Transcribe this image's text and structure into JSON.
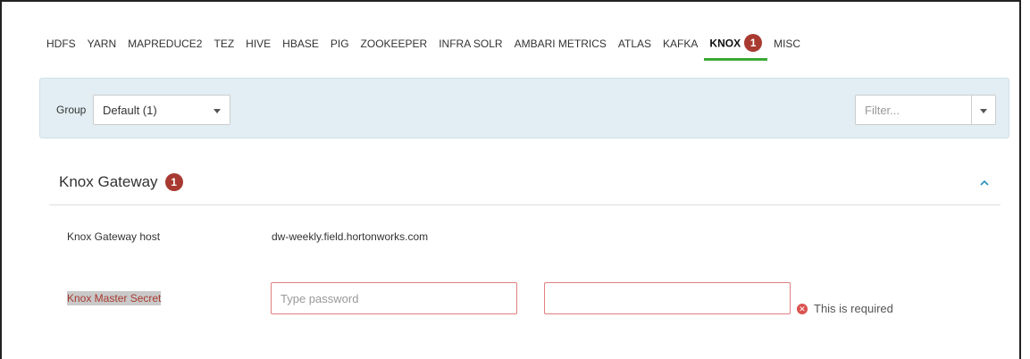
{
  "tabs": [
    {
      "label": "HDFS"
    },
    {
      "label": "YARN"
    },
    {
      "label": "MAPREDUCE2"
    },
    {
      "label": "TEZ"
    },
    {
      "label": "HIVE"
    },
    {
      "label": "HBASE"
    },
    {
      "label": "PIG"
    },
    {
      "label": "ZOOKEEPER"
    },
    {
      "label": "INFRA SOLR"
    },
    {
      "label": "AMBARI METRICS"
    },
    {
      "label": "ATLAS"
    },
    {
      "label": "KAFKA"
    },
    {
      "label": "KNOX",
      "badge": "1",
      "active": true
    },
    {
      "label": "MISC"
    }
  ],
  "filter_bar": {
    "group_label": "Group",
    "group_value": "Default (1)",
    "filter_placeholder": "Filter..."
  },
  "section": {
    "title": "Knox Gateway",
    "badge": "1",
    "host_label": "Knox Gateway host",
    "host_value": "dw-weekly.field.hortonworks.com",
    "secret_label": "Knox Master Secret",
    "password_placeholder": "Type password",
    "confirm_value": "",
    "error_text": "This is required"
  },
  "colors": {
    "active_tab_underline": "#3aa935",
    "badge": "#a83a31",
    "error_border": "#e07f7f",
    "error_icon": "#d9534f",
    "filter_bar_bg": "#e2eef3",
    "chevron": "#2a8fbd"
  },
  "icons": {
    "collapse": "chevron-up-icon",
    "error": "error-circle-icon",
    "dropdown": "caret-down-icon"
  }
}
